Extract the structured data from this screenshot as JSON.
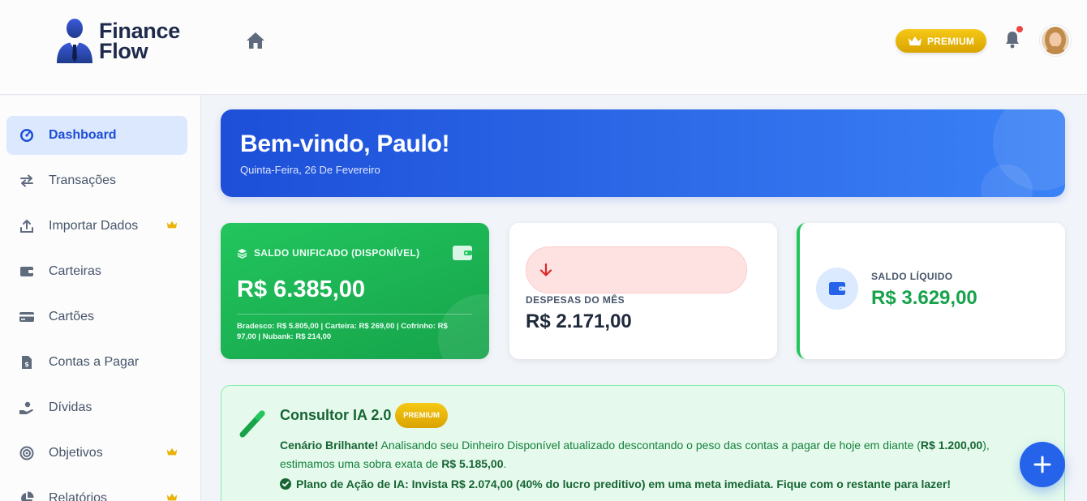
{
  "brand": {
    "line1": "Finance",
    "line2": "Flow"
  },
  "header": {
    "premium_label": "PREMIUM",
    "home_icon": "home-icon",
    "bell_icon": "bell-icon"
  },
  "sidebar": {
    "items": [
      {
        "label": "Dashboard",
        "icon": "dashboard-icon",
        "active": true,
        "premium": false
      },
      {
        "label": "Transações",
        "icon": "transfer-icon",
        "active": false,
        "premium": false
      },
      {
        "label": "Importar Dados",
        "icon": "upload-icon",
        "active": false,
        "premium": true
      },
      {
        "label": "Carteiras",
        "icon": "wallet-icon",
        "active": false,
        "premium": false
      },
      {
        "label": "Cartões",
        "icon": "credit-card-icon",
        "active": false,
        "premium": false
      },
      {
        "label": "Contas a Pagar",
        "icon": "invoice-icon",
        "active": false,
        "premium": false
      },
      {
        "label": "Dívidas",
        "icon": "debt-icon",
        "active": false,
        "premium": false
      },
      {
        "label": "Objetivos",
        "icon": "target-icon",
        "active": false,
        "premium": true
      },
      {
        "label": "Relatórios",
        "icon": "chart-pie-icon",
        "active": false,
        "premium": true
      }
    ]
  },
  "welcome": {
    "title": "Bem-vindo, Paulo!",
    "date": "Quinta-Feira, 26 De Fevereiro"
  },
  "cards": {
    "balance": {
      "title": "SALDO UNIFICADO (DISPONÍVEL)",
      "amount": "R$ 6.385,00",
      "breakdown": "Bradesco: R$ 5.805,00 | Carteira: R$ 269,00 | Cofrinho: R$ 97,00 | Nubank: R$ 214,00"
    },
    "expenses": {
      "label": "DESPESAS DO MÊS",
      "amount": "R$ 2.171,00"
    },
    "net": {
      "label": "SALDO LÍQUIDO",
      "amount": "R$ 3.629,00"
    }
  },
  "ai": {
    "title": "Consultor IA 2.0",
    "badge": "PREMIUM",
    "lead": "Cenário Brilhante!",
    "text_1": " Analisando seu Dinheiro Disponível atualizado descontando o peso das contas a pagar de hoje em diante (",
    "bills_amount": "R$ 1.200,00",
    "text_2": "), estimamos uma sobra exata de ",
    "surplus_amount": "R$ 5.185,00",
    "text_3": ".",
    "plan": "Plano de Ação de IA: Invista R$ 2.074,00 (40% do lucro preditivo) em uma meta imediata. Fique com o restante para lazer!"
  },
  "colors": {
    "primary": "#2563eb",
    "success": "#16a34a",
    "gold": "#eab308",
    "danger": "#ef4444"
  }
}
